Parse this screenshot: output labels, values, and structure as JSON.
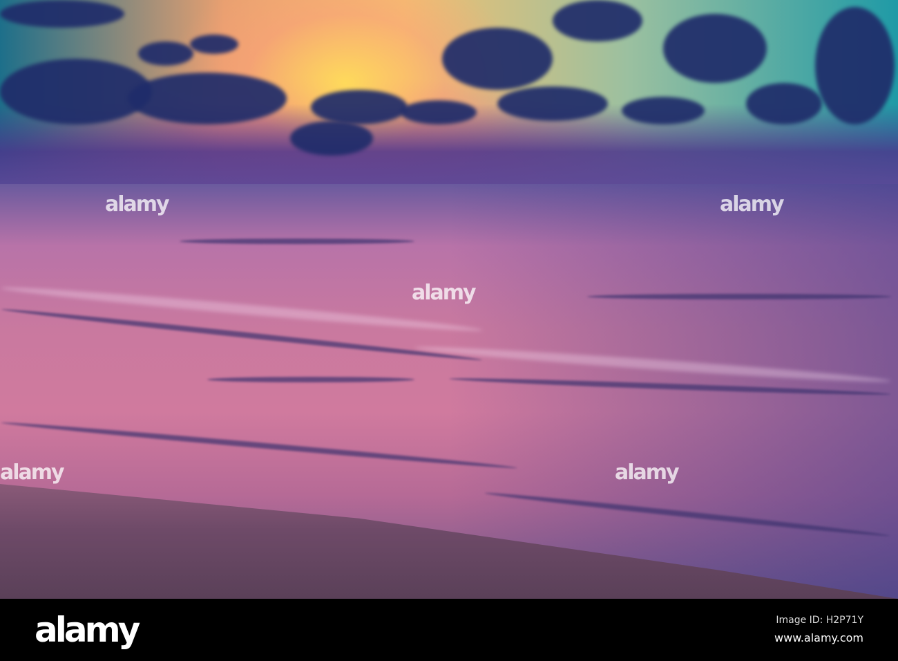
{
  "photo": {
    "subject": "sunset-over-sea-beach"
  },
  "watermark": {
    "text": "alamy"
  },
  "footer": {
    "logo": "alamy",
    "image_id": "Image ID: H2P71Y",
    "website": "www.alamy.com"
  }
}
